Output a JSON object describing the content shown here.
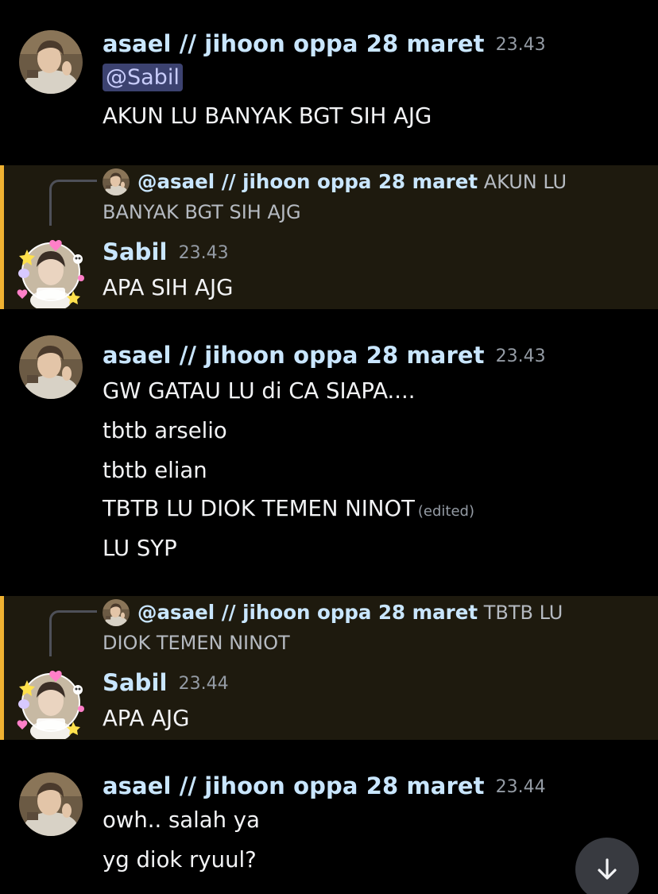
{
  "colors": {
    "background": "#000000",
    "username": "#c9e6ff",
    "mention_bg": "#1e1a0e",
    "mention_bar": "#f0b232",
    "mention_chip_bg": "#3c4270",
    "timestamp": "#949ba4"
  },
  "messages": [
    {
      "author": "asael // jihoon oppa 28 maret",
      "time": "23.43",
      "mention": "@Sabil",
      "lines": [
        "AKUN LU BANYAK BGT SIH AJG"
      ]
    },
    {
      "reply_to": {
        "author": "@asael // jihoon oppa 28 maret",
        "text": "AKUN LU BANYAK BGT SIH AJG"
      },
      "author": "Sabil",
      "time": "23.43",
      "lines": [
        "APA SIH AJG"
      ]
    },
    {
      "author": "asael // jihoon oppa 28 maret",
      "time": "23.43",
      "lines": [
        "GW GATAU LU di CA SIAPA....",
        "tbtb arselio",
        "tbtb elian",
        "TBTB LU DIOK TEMEN NINOT",
        "LU SYP"
      ],
      "edited_label": "(edited)"
    },
    {
      "reply_to": {
        "author": "@asael // jihoon oppa 28 maret",
        "text": "TBTB LU DIOK TEMEN NINOT"
      },
      "author": "Sabil",
      "time": "23.44",
      "lines": [
        "APA AJG"
      ]
    },
    {
      "author": "asael // jihoon oppa 28 maret",
      "time": "23.44",
      "lines": [
        "owh.. salah ya",
        "yg diok ryuul?"
      ]
    }
  ],
  "icons": {
    "scroll_down": "arrow-down-icon"
  }
}
